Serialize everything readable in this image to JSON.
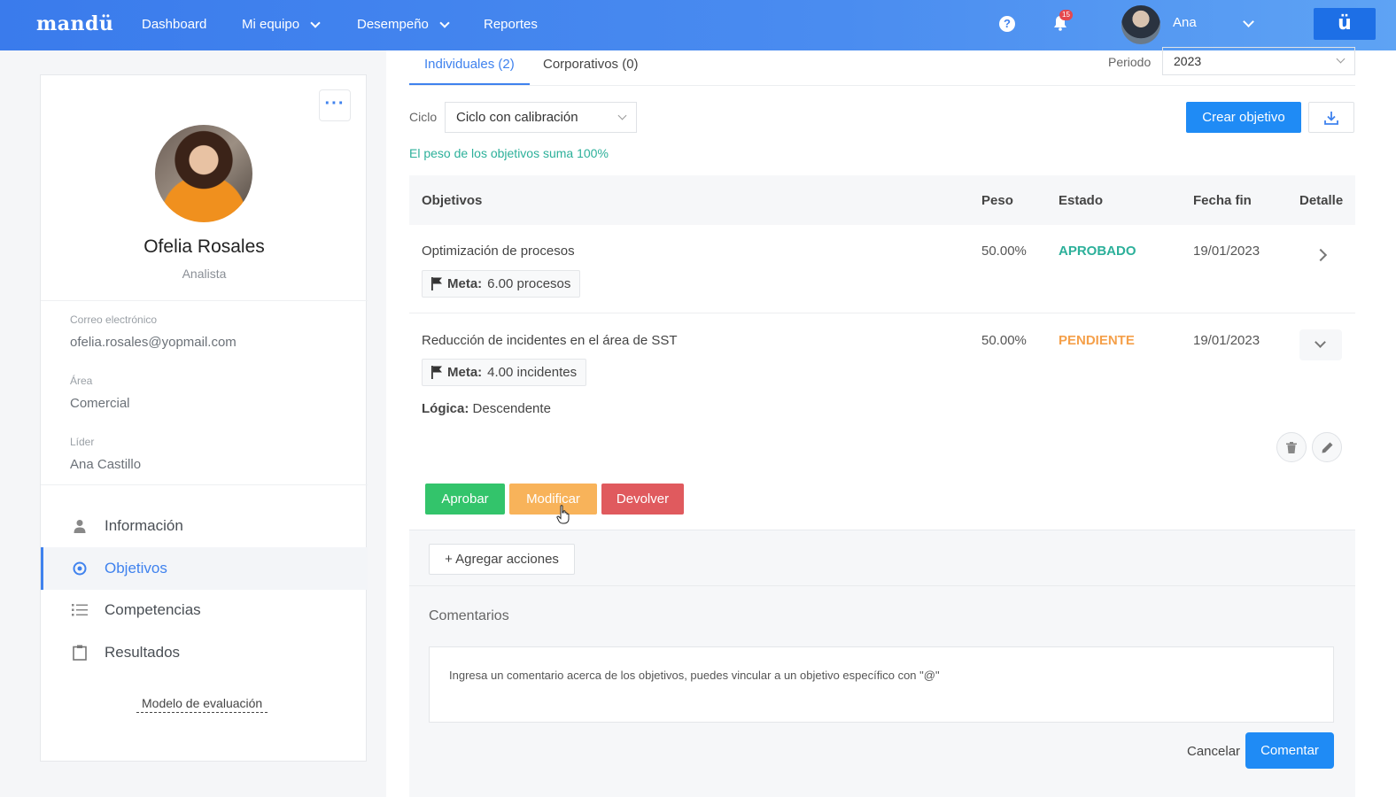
{
  "nav": {
    "logo": "mandü",
    "items": [
      "Dashboard",
      "Mi equipo",
      "Desempeño",
      "Reportes"
    ],
    "notifications_count": "15",
    "user_name": "Ana",
    "brand_short": "ü",
    "help_glyph": "?"
  },
  "profile": {
    "more_glyph": "···",
    "name": "Ofelia Rosales",
    "role": "Analista",
    "fields": [
      {
        "label": "Correo electrónico",
        "value": "ofelia.rosales@yopmail.com"
      },
      {
        "label": "Área",
        "value": "Comercial"
      },
      {
        "label": "Líder",
        "value": "Ana Castillo"
      }
    ],
    "menu": [
      {
        "label": "Información",
        "icon": "person-icon"
      },
      {
        "label": "Objetivos",
        "icon": "target-icon"
      },
      {
        "label": "Competencias",
        "icon": "list-icon"
      },
      {
        "label": "Resultados",
        "icon": "clipboard-icon"
      }
    ],
    "eval_link": "Modelo de evaluación"
  },
  "tabs": [
    "Individuales (2)",
    "Corporativos (0)"
  ],
  "periodo": {
    "label": "Periodo",
    "value": "2023"
  },
  "ciclo": {
    "label": "Ciclo",
    "value": "Ciclo con calibración"
  },
  "create_button": "Crear objetivo",
  "weight_note": "El peso de los objetivos suma 100%",
  "table": {
    "headers": [
      "Objetivos",
      "Peso",
      "Estado",
      "Fecha fin",
      "Detalle"
    ],
    "rows": [
      {
        "title": "Optimización de procesos",
        "weight": "50.00%",
        "status": "APROBADO",
        "status_color": "#2cb09a",
        "date": "19/01/2023",
        "meta_label": "Meta:",
        "meta_value": "6.00 procesos"
      },
      {
        "title": "Reducción de incidentes en el área de SST",
        "weight": "50.00%",
        "status": "PENDIENTE",
        "status_color": "#f5a04a",
        "date": "19/01/2023",
        "meta_label": "Meta:",
        "meta_value": "4.00 incidentes",
        "logic_label": "Lógica:",
        "logic_value": "Descendente"
      }
    ]
  },
  "actions": {
    "approve": "Aprobar",
    "approve_color": "#33c46b",
    "modify": "Modificar",
    "modify_color": "#f8b35a",
    "return": "Devolver",
    "return_color": "#e05a5e"
  },
  "add_actions": "+ Agregar acciones",
  "comments": {
    "title": "Comentarios",
    "placeholder": "Ingresa un comentario acerca de los objetivos, puedes vincular a un objetivo específico con \"@\"",
    "cancel": "Cancelar",
    "submit": "Comentar"
  }
}
